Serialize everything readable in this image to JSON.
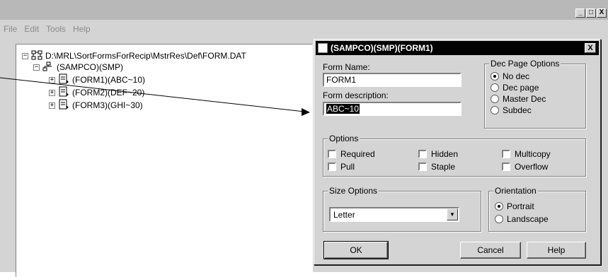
{
  "window": {
    "buttons": [
      "_",
      "□",
      "X"
    ]
  },
  "menu": [
    "File",
    "Edit",
    "Tools",
    "Help"
  ],
  "tree": {
    "root": {
      "label": "D:\\MRL\\SortFormsForRecip\\MstrRes\\Def\\FORM.DAT",
      "expander": "−"
    },
    "group": {
      "label": "(SAMPCO)(SMP)",
      "expander": "−"
    },
    "forms": [
      {
        "label": "(FORM1)(ABC~10)",
        "expander": "+"
      },
      {
        "label": "(FORM2)(DEF~20)",
        "expander": "+"
      },
      {
        "label": "(FORM3)(GHI~30)",
        "expander": "+"
      }
    ]
  },
  "dialog": {
    "title": "(SAMPCO)(SMP)(FORM1)",
    "close": "X",
    "form_name_label": "Form Name:",
    "form_name_value": "FORM1",
    "form_desc_label": "Form description:",
    "form_desc_value": "ABC~10",
    "dec_group": {
      "title": "Dec Page Options",
      "options": [
        {
          "label": "No dec",
          "selected": true
        },
        {
          "label": "Dec page",
          "selected": false
        },
        {
          "label": "Master Dec",
          "selected": false
        },
        {
          "label": "Subdec",
          "selected": false
        }
      ]
    },
    "options_group": {
      "title": "Options",
      "checks": [
        "Required",
        "Hidden",
        "Multicopy",
        "Pull",
        "Staple",
        "Overflow"
      ]
    },
    "size_group": {
      "title": "Size Options",
      "selected": "Letter"
    },
    "orientation_group": {
      "title": "Orientation",
      "options": [
        {
          "label": "Portrait",
          "selected": true
        },
        {
          "label": "Landscape",
          "selected": false
        }
      ]
    },
    "buttons": {
      "ok": "OK",
      "cancel": "Cancel",
      "help": "Help"
    }
  }
}
